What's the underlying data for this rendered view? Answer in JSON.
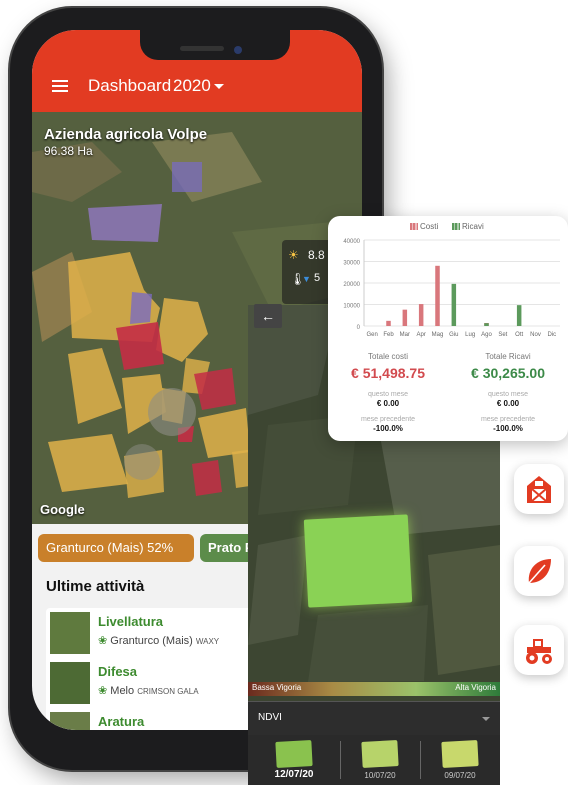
{
  "header": {
    "title": "Dashboard",
    "year": "2020"
  },
  "map": {
    "farm_name": "Azienda agricola Volpe",
    "farm_area": "96.38 Ha",
    "attribution": "Google"
  },
  "weather": {
    "temp_value": "8.8",
    "second_value": "5"
  },
  "crop_chips": [
    {
      "label": "Granturco (Mais) 52%"
    },
    {
      "label": "Prato P"
    }
  ],
  "activities_title": "Ultime attività",
  "activities": [
    {
      "name": "Livellatura",
      "crop": "Granturco (Mais)",
      "variety": "WAXY"
    },
    {
      "name": "Difesa",
      "crop": "Melo",
      "variety": "CRIMSON GALA"
    },
    {
      "name": "Aratura",
      "crop": "",
      "variety": ""
    }
  ],
  "ndvi": {
    "scale_low": "Bassa Vigoria",
    "scale_high": "Alta Vigoria",
    "index": "NDVI",
    "dates": [
      "12/07/20",
      "10/07/20",
      "09/07/20"
    ],
    "selected_date": "12/07/20"
  },
  "finance": {
    "total_costs_label": "Totale costi",
    "total_revenue_label": "Totale Ricavi",
    "total_costs": "€ 51,498.75",
    "total_revenue": "€ 30,265.00",
    "this_month_label": "questo mese",
    "this_month_costs": "€ 0.00",
    "this_month_revenue": "€ 0.00",
    "prev_month_label": "mese precedente",
    "prev_month_costs": "-100.0%",
    "prev_month_revenue": "-100.0%"
  },
  "chart_data": {
    "type": "bar",
    "categories": [
      "Gen",
      "Feb",
      "Mar",
      "Apr",
      "Mag",
      "Giu",
      "Lug",
      "Ago",
      "Set",
      "Ott",
      "Nov",
      "Dic"
    ],
    "series": [
      {
        "name": "Costi",
        "color": "#d9777c",
        "values": [
          0,
          2400,
          7600,
          10200,
          28000,
          0,
          0,
          1400,
          0,
          0,
          0,
          0
        ]
      },
      {
        "name": "Ricavi",
        "color": "#5c9a5c",
        "values": [
          0,
          0,
          0,
          0,
          0,
          19600,
          0,
          1300,
          0,
          9700,
          0,
          0
        ]
      }
    ],
    "yticks": [
      "0",
      "10000",
      "20000",
      "30000",
      "40000"
    ],
    "ylim": [
      0,
      40000
    ],
    "legend": "top-center"
  },
  "colors": {
    "primary": "#e23b22",
    "green": "#3d8b2f",
    "costs": "#d24a4e",
    "revenue": "#3c8a48"
  },
  "side_icons": [
    "barn-icon",
    "leaf-icon",
    "tractor-icon"
  ]
}
